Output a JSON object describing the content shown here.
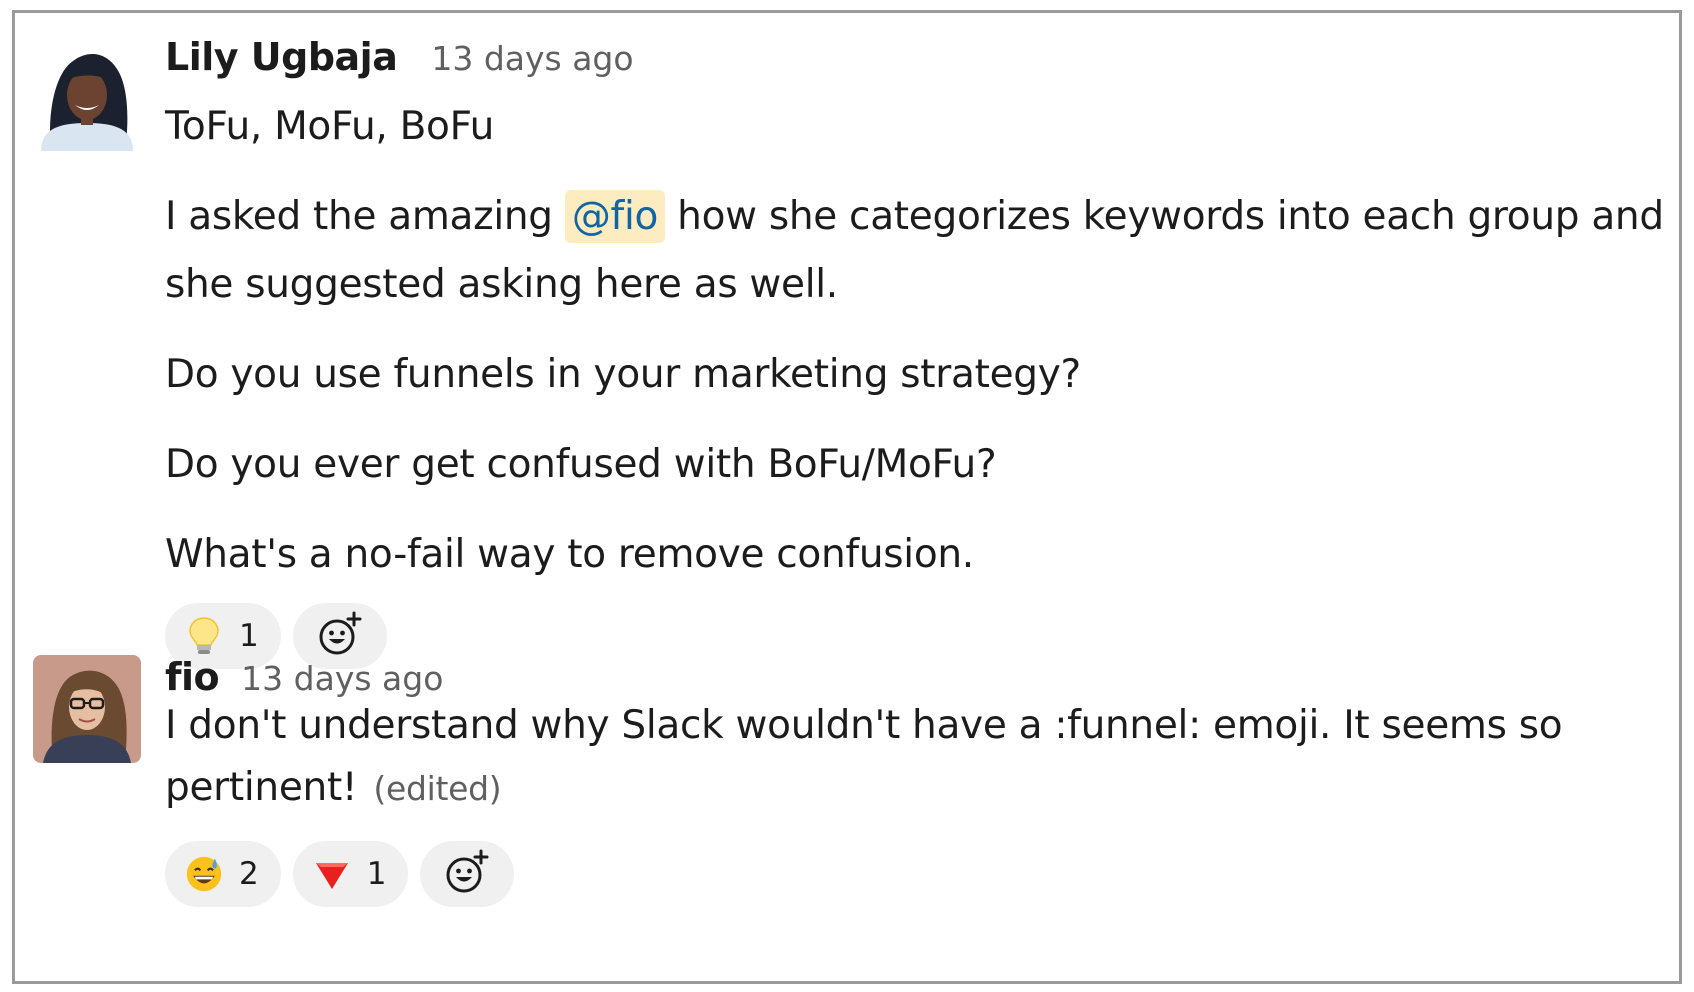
{
  "messages": [
    {
      "author": "Lily Ugbaja",
      "time": "13 days ago",
      "avatar_icon": "user-avatar-lily",
      "line1": "ToFu, MoFu, BoFu",
      "p2_before": "I asked the amazing ",
      "p2_mention": "@fio",
      "p2_after": " how she categorizes keywords into each group and she suggested asking here as well.",
      "line3": "Do you use funnels in your marketing strategy?",
      "line4": "Do you ever get confused with BoFu/MoFu?",
      "line5": "What's a no-fail way to remove confusion.",
      "reactions": [
        {
          "emoji": "light-bulb-icon",
          "count": "1"
        }
      ]
    },
    {
      "author": "fio",
      "time": "13 days ago",
      "avatar_icon": "user-avatar-fio",
      "text": "I don't understand why Slack wouldn't have a :funnel: emoji. It seems so pertinent!",
      "edited": "(edited)",
      "reactions": [
        {
          "emoji": "grinning-sweat-face-icon",
          "count": "2"
        },
        {
          "emoji": "red-triangle-down-icon",
          "count": "1"
        }
      ]
    }
  ],
  "colors": {
    "mention_bg": "#fcecc0",
    "mention_text": "#1264a3",
    "reaction_bg": "#f0f0f0",
    "secondary_text": "#616061"
  }
}
